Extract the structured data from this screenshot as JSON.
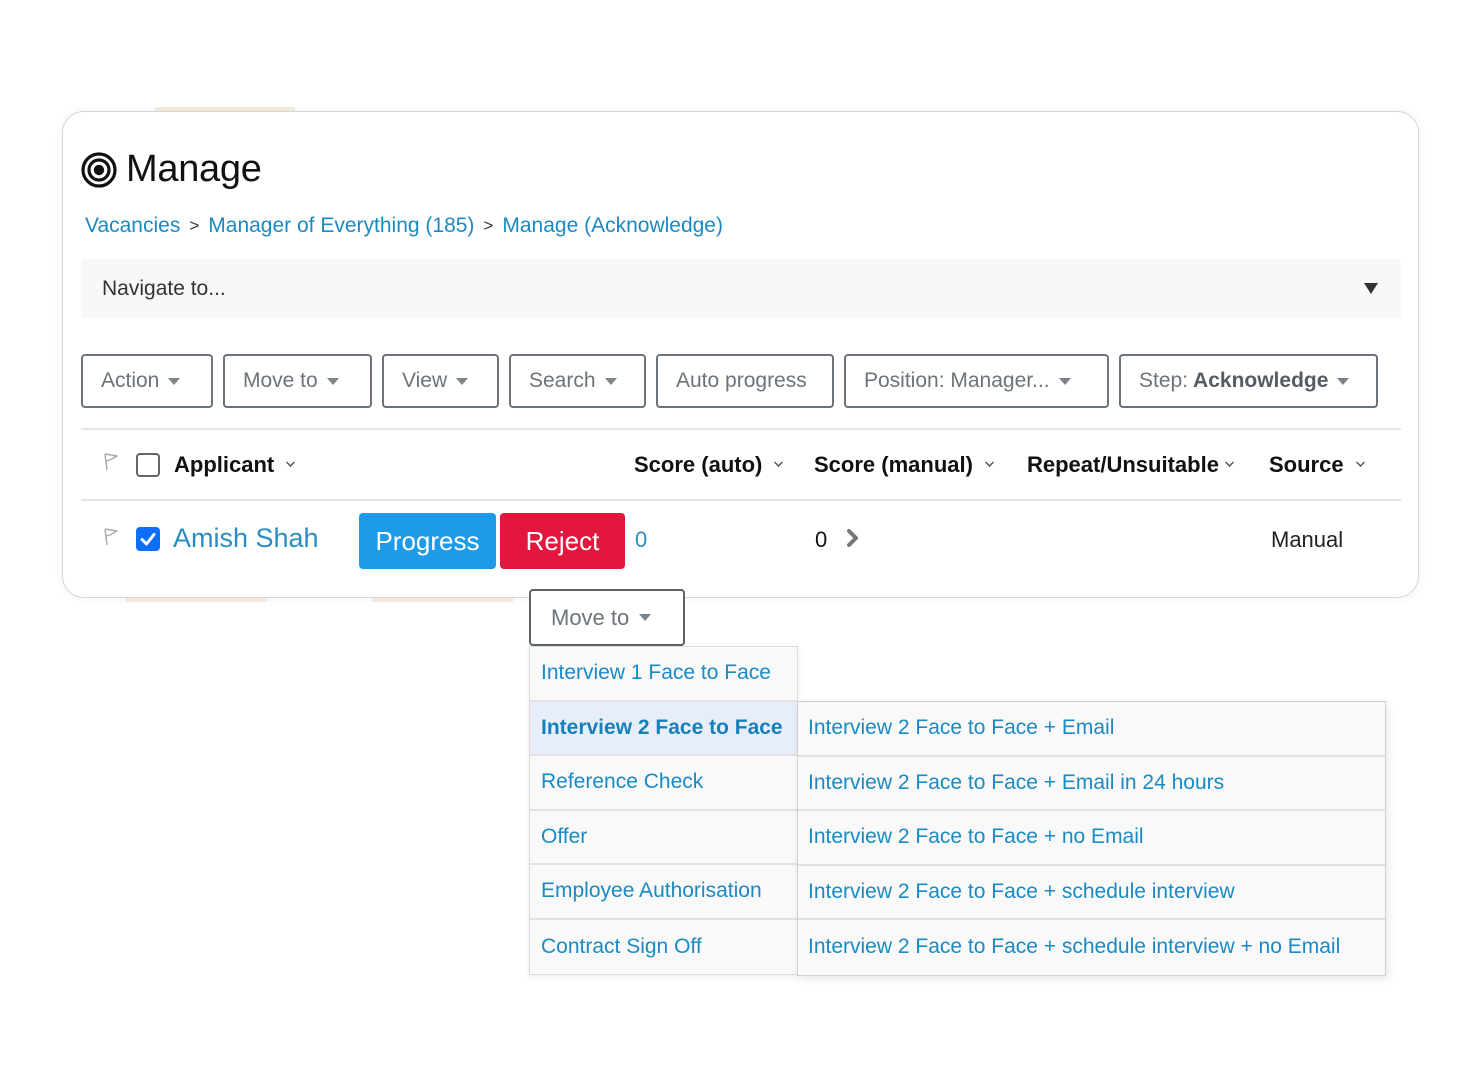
{
  "page": {
    "title": "Manage",
    "title_icon": "target-icon"
  },
  "breadcrumb": {
    "items": [
      "Vacancies",
      "Manager of Everything (185)",
      "Manage (Acknowledge)"
    ],
    "separator": ">"
  },
  "navigate": {
    "placeholder": "Navigate to..."
  },
  "toolbar": {
    "action": "Action",
    "move_to": "Move to",
    "view": "View",
    "search": "Search",
    "auto_progress": "Auto progress",
    "position": "Position: Manager...",
    "step_prefix": "Step:",
    "step_value": "Acknowledge"
  },
  "table": {
    "columns": {
      "applicant": "Applicant",
      "score_auto": "Score (auto)",
      "score_manual": "Score (manual)",
      "repeat_unsuitable": "Repeat/Unsuitable",
      "source": "Source"
    },
    "header_checkbox_checked": false,
    "rows": [
      {
        "checked": true,
        "applicant": "Amish Shah",
        "progress_label": "Progress",
        "reject_label": "Reject",
        "score_auto": "0",
        "score_manual": "0",
        "repeat_unsuitable": "",
        "source": "Manual"
      }
    ]
  },
  "move_to_menu": {
    "button_label": "Move to",
    "items": [
      "Interview 1 Face to Face",
      "Interview 2 Face to Face",
      "Reference Check",
      "Offer",
      "Employee Authorisation",
      "Contract Sign Off"
    ],
    "active_item": "Interview 2 Face to Face",
    "submenu": [
      "Interview 2 Face to Face + Email",
      "Interview 2 Face to Face + Email in 24 hours",
      "Interview 2 Face to Face + no Email",
      "Interview 2 Face to Face + schedule interview",
      "Interview 2 Face to Face + schedule interview + no Email"
    ]
  },
  "colors": {
    "link": "#1a8ac4",
    "progress": "#1d9be8",
    "reject": "#e3163e",
    "checkbox": "#0d6efd",
    "active_menu_bg": "#e8eef8"
  }
}
